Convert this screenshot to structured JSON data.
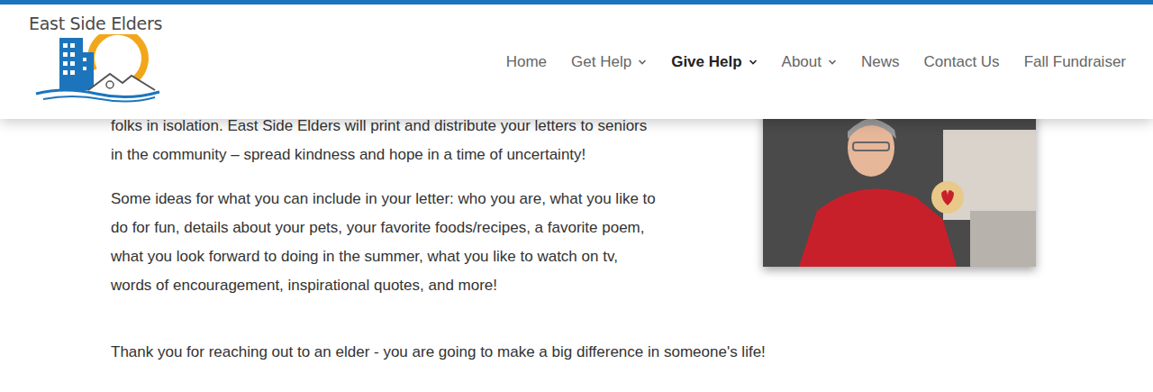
{
  "logo": {
    "text": "East Side Elders"
  },
  "nav": [
    {
      "label": "Home",
      "dropdown": false,
      "selected": false
    },
    {
      "label": "Get Help",
      "dropdown": true,
      "selected": false
    },
    {
      "label": "Give Help",
      "dropdown": true,
      "selected": true
    },
    {
      "label": "About",
      "dropdown": true,
      "selected": false
    },
    {
      "label": "News",
      "dropdown": false,
      "selected": false
    },
    {
      "label": "Contact Us",
      "dropdown": false,
      "selected": false
    },
    {
      "label": "Fall Fundraiser",
      "dropdown": false,
      "selected": false
    }
  ],
  "content": {
    "intro_lines": [
      "folks in isolation. East Side Elders will print and distribute your letters to seniors",
      "in the community – spread kindness and hope in a time of uncertainty!"
    ],
    "ideas_lines": [
      "Some ideas for what you can include in your letter:  who you are, what you like to",
      "do for fun, details about your pets, your favorite foods/recipes, a favorite poem,",
      "what you look forward to doing in the summer, what you like to watch on tv,",
      "words of encouragement, inspirational quotes, and more!"
    ],
    "closing": "Thank you for reaching out to an elder - you are going to make a big difference in someone's life!"
  }
}
